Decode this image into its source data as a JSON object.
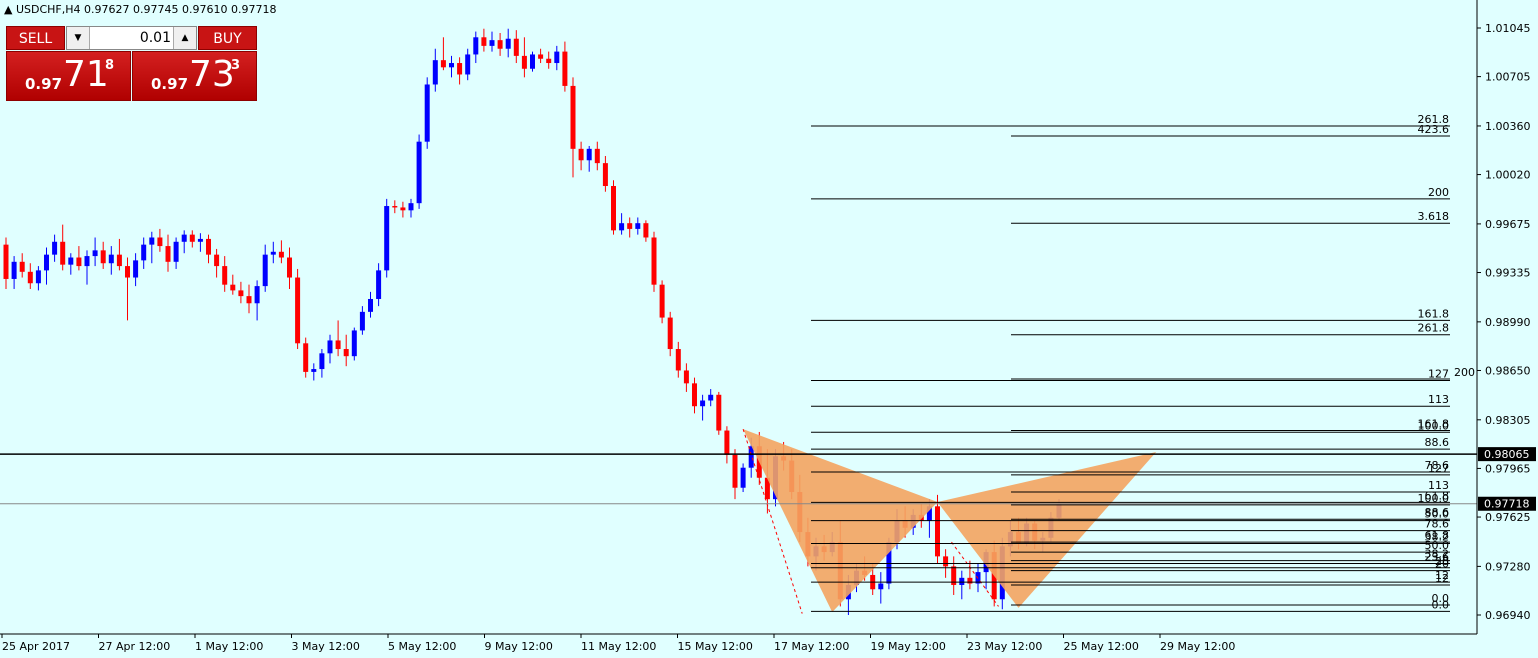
{
  "header": {
    "symbol": "USDCHF,H4",
    "ohlc": "0.97627 0.97745 0.97610 0.97718",
    "collapse_icon": "triangle-up-icon"
  },
  "trade_panel": {
    "sell_label": "SELL",
    "buy_label": "BUY",
    "lot_value": "0.01",
    "sell_price_prefix": "0.97",
    "sell_price_big": "71",
    "sell_price_sup": "8",
    "buy_price_prefix": "0.97",
    "buy_price_big": "73",
    "buy_price_sup": "3"
  },
  "colors": {
    "background": "#e0ffff",
    "bull_candle": "#0000ff",
    "bear_candle": "#ff0000",
    "pattern_fill": "#f4a460",
    "button_red": "#c81414"
  },
  "chart_data": {
    "type": "candlestick",
    "symbol": "USDCHF",
    "timeframe": "H4",
    "y_ticks": [
      "1.01045",
      "1.00705",
      "1.00360",
      "1.00020",
      "0.99675",
      "0.99335",
      "0.98990",
      "0.98650",
      "0.98305",
      "0.97965",
      "0.97625",
      "0.97280",
      "0.96940"
    ],
    "ylim": [
      0.9685,
      1.0125
    ],
    "x_ticks": [
      "25 Apr 2017",
      "27 Apr 12:00",
      "1 May 12:00",
      "3 May 12:00",
      "5 May 12:00",
      "9 May 12:00",
      "11 May 12:00",
      "15 May 12:00",
      "17 May 12:00",
      "19 May 12:00",
      "23 May 12:00",
      "25 May 12:00",
      "29 May 12:00"
    ],
    "price_labels": [
      {
        "value": "0.98065",
        "style": "black"
      },
      {
        "value": "0.97718",
        "style": "black"
      }
    ],
    "horizontal_lines": [
      {
        "price": 0.98065,
        "kind": "level"
      },
      {
        "price": 0.97718,
        "kind": "bid"
      }
    ],
    "candles": [
      [
        0.9953,
        0.9958,
        0.9922,
        0.9929
      ],
      [
        0.9929,
        0.9945,
        0.9922,
        0.9941
      ],
      [
        0.9941,
        0.9947,
        0.993,
        0.9934
      ],
      [
        0.9934,
        0.994,
        0.9922,
        0.9926
      ],
      [
        0.9926,
        0.9938,
        0.9921,
        0.9935
      ],
      [
        0.9935,
        0.9951,
        0.9925,
        0.9946
      ],
      [
        0.9946,
        0.996,
        0.9941,
        0.9955
      ],
      [
        0.9955,
        0.9967,
        0.9935,
        0.9939
      ],
      [
        0.9939,
        0.9947,
        0.9932,
        0.9944
      ],
      [
        0.9944,
        0.9952,
        0.9935,
        0.9938
      ],
      [
        0.9938,
        0.9949,
        0.9925,
        0.9945
      ],
      [
        0.9945,
        0.9958,
        0.9938,
        0.9949
      ],
      [
        0.9949,
        0.9955,
        0.9936,
        0.994
      ],
      [
        0.994,
        0.9952,
        0.9932,
        0.9946
      ],
      [
        0.9946,
        0.9957,
        0.9935,
        0.9938
      ],
      [
        0.9938,
        0.9944,
        0.99,
        0.993
      ],
      [
        0.993,
        0.9947,
        0.9924,
        0.9942
      ],
      [
        0.9942,
        0.9958,
        0.9936,
        0.9953
      ],
      [
        0.9953,
        0.9962,
        0.994,
        0.9958
      ],
      [
        0.9958,
        0.9964,
        0.9948,
        0.9952
      ],
      [
        0.9952,
        0.996,
        0.9934,
        0.9941
      ],
      [
        0.9941,
        0.9958,
        0.9936,
        0.9955
      ],
      [
        0.9955,
        0.9963,
        0.9947,
        0.996
      ],
      [
        0.996,
        0.9963,
        0.9951,
        0.9955
      ],
      [
        0.9955,
        0.9961,
        0.9948,
        0.9957
      ],
      [
        0.9957,
        0.996,
        0.994,
        0.9946
      ],
      [
        0.9946,
        0.995,
        0.993,
        0.9938
      ],
      [
        0.9938,
        0.9945,
        0.992,
        0.9925
      ],
      [
        0.9925,
        0.9932,
        0.9918,
        0.9921
      ],
      [
        0.9921,
        0.9927,
        0.9912,
        0.9917
      ],
      [
        0.9917,
        0.9925,
        0.9905,
        0.9912
      ],
      [
        0.9912,
        0.9928,
        0.99,
        0.9924
      ],
      [
        0.9924,
        0.9953,
        0.992,
        0.9946
      ],
      [
        0.9946,
        0.9955,
        0.994,
        0.9948
      ],
      [
        0.9948,
        0.9956,
        0.994,
        0.9944
      ],
      [
        0.9944,
        0.9951,
        0.9922,
        0.993
      ],
      [
        0.993,
        0.9936,
        0.988,
        0.9884
      ],
      [
        0.9884,
        0.9888,
        0.986,
        0.9864
      ],
      [
        0.9864,
        0.987,
        0.9858,
        0.9866
      ],
      [
        0.9866,
        0.988,
        0.986,
        0.9877
      ],
      [
        0.9877,
        0.989,
        0.987,
        0.9886
      ],
      [
        0.9886,
        0.99,
        0.9875,
        0.988
      ],
      [
        0.988,
        0.989,
        0.9868,
        0.9875
      ],
      [
        0.9875,
        0.9895,
        0.9872,
        0.9893
      ],
      [
        0.9893,
        0.991,
        0.989,
        0.9906
      ],
      [
        0.9906,
        0.992,
        0.9902,
        0.9915
      ],
      [
        0.9915,
        0.994,
        0.991,
        0.9935
      ],
      [
        0.9935,
        0.9985,
        0.993,
        0.998
      ],
      [
        0.998,
        0.9984,
        0.9975,
        0.9979
      ],
      [
        0.9979,
        0.9983,
        0.9972,
        0.9977
      ],
      [
        0.9977,
        0.9985,
        0.9972,
        0.9982
      ],
      [
        0.9982,
        1.003,
        0.9978,
        1.0025
      ],
      [
        1.0025,
        1.007,
        1.002,
        1.0065
      ],
      [
        1.0065,
        1.009,
        1.006,
        1.0082
      ],
      [
        1.0082,
        1.0098,
        1.0075,
        1.0077
      ],
      [
        1.0077,
        1.0085,
        1.007,
        1.008
      ],
      [
        1.008,
        1.0084,
        1.0065,
        1.0072
      ],
      [
        1.0072,
        1.009,
        1.0068,
        1.0086
      ],
      [
        1.0086,
        1.0102,
        1.008,
        1.0098
      ],
      [
        1.0098,
        1.0104,
        1.0088,
        1.0092
      ],
      [
        1.0092,
        1.0102,
        1.0088,
        1.0096
      ],
      [
        1.0096,
        1.0101,
        1.0085,
        1.009
      ],
      [
        1.009,
        1.0104,
        1.0084,
        1.0097
      ],
      [
        1.0097,
        1.0103,
        1.008,
        1.0085
      ],
      [
        1.0085,
        1.0098,
        1.007,
        1.0076
      ],
      [
        1.0076,
        1.0088,
        1.0074,
        1.0086
      ],
      [
        1.0086,
        1.009,
        1.008,
        1.0083
      ],
      [
        1.0083,
        1.0088,
        1.0076,
        1.008
      ],
      [
        1.008,
        1.0092,
        1.0075,
        1.0088
      ],
      [
        1.0088,
        1.0095,
        1.006,
        1.0064
      ],
      [
        1.0064,
        1.007,
        1.0,
        1.002
      ],
      [
        1.002,
        1.0025,
        1.0005,
        1.0012
      ],
      [
        1.0012,
        1.0022,
        1.0004,
        1.002
      ],
      [
        1.002,
        1.0025,
        1.0005,
        1.001
      ],
      [
        1.001,
        1.0015,
        0.999,
        0.9994
      ],
      [
        0.9994,
        0.9998,
        0.996,
        0.9963
      ],
      [
        0.9963,
        0.9975,
        0.996,
        0.9968
      ],
      [
        0.9968,
        0.9972,
        0.9958,
        0.9964
      ],
      [
        0.9964,
        0.9972,
        0.996,
        0.9968
      ],
      [
        0.9968,
        0.997,
        0.9955,
        0.9958
      ],
      [
        0.9958,
        0.9962,
        0.992,
        0.9925
      ],
      [
        0.9925,
        0.9928,
        0.9898,
        0.9902
      ],
      [
        0.9902,
        0.9906,
        0.9875,
        0.988
      ],
      [
        0.988,
        0.9885,
        0.986,
        0.9865
      ],
      [
        0.9865,
        0.987,
        0.985,
        0.9856
      ],
      [
        0.9856,
        0.986,
        0.9835,
        0.984
      ],
      [
        0.984,
        0.9848,
        0.983,
        0.9844
      ],
      [
        0.9844,
        0.9852,
        0.984,
        0.9848
      ],
      [
        0.9848,
        0.985,
        0.982,
        0.9823
      ],
      [
        0.9823,
        0.9826,
        0.98,
        0.9806
      ],
      [
        0.9806,
        0.981,
        0.9775,
        0.9783
      ],
      [
        0.9783,
        0.98,
        0.978,
        0.9797
      ],
      [
        0.9797,
        0.9818,
        0.979,
        0.9812
      ],
      [
        0.9812,
        0.9822,
        0.9785,
        0.979
      ],
      [
        0.979,
        0.981,
        0.9765,
        0.9775
      ],
      [
        0.9775,
        0.981,
        0.977,
        0.9805
      ],
      [
        0.9805,
        0.9815,
        0.9795,
        0.9802
      ],
      [
        0.9802,
        0.981,
        0.9775,
        0.978
      ],
      [
        0.978,
        0.9792,
        0.9745,
        0.9752
      ],
      [
        0.9752,
        0.9762,
        0.9728,
        0.9735
      ],
      [
        0.9735,
        0.9748,
        0.9725,
        0.9742
      ],
      [
        0.9742,
        0.975,
        0.9732,
        0.9738
      ],
      [
        0.9738,
        0.9752,
        0.9735,
        0.9745
      ],
      [
        0.9745,
        0.976,
        0.97,
        0.9705
      ],
      [
        0.9705,
        0.9722,
        0.9694,
        0.9715
      ],
      [
        0.9715,
        0.973,
        0.971,
        0.9725
      ],
      [
        0.9725,
        0.9735,
        0.9718,
        0.9722
      ],
      [
        0.9722,
        0.973,
        0.9708,
        0.9712
      ],
      [
        0.9712,
        0.9724,
        0.9702,
        0.9716
      ],
      [
        0.9716,
        0.9748,
        0.9712,
        0.9745
      ],
      [
        0.9745,
        0.9768,
        0.974,
        0.976
      ],
      [
        0.976,
        0.977,
        0.9748,
        0.9755
      ],
      [
        0.9755,
        0.9768,
        0.975,
        0.9764
      ],
      [
        0.9764,
        0.9772,
        0.9755,
        0.976
      ],
      [
        0.976,
        0.9775,
        0.9748,
        0.977
      ],
      [
        0.977,
        0.9778,
        0.973,
        0.9735
      ],
      [
        0.9735,
        0.974,
        0.972,
        0.9728
      ],
      [
        0.9728,
        0.9735,
        0.9708,
        0.9715
      ],
      [
        0.9715,
        0.9725,
        0.9705,
        0.972
      ],
      [
        0.972,
        0.9732,
        0.9712,
        0.9716
      ],
      [
        0.9716,
        0.973,
        0.971,
        0.9724
      ],
      [
        0.9724,
        0.974,
        0.9712,
        0.9738
      ],
      [
        0.9738,
        0.9746,
        0.97,
        0.9705
      ],
      [
        0.9705,
        0.9748,
        0.9698,
        0.9742
      ],
      [
        0.9742,
        0.976,
        0.9735,
        0.9752
      ],
      [
        0.9752,
        0.9762,
        0.974,
        0.9744
      ],
      [
        0.9744,
        0.9762,
        0.9742,
        0.9758
      ],
      [
        0.9758,
        0.976,
        0.974,
        0.9746
      ],
      [
        0.9746,
        0.9752,
        0.9738,
        0.9748
      ],
      [
        0.9748,
        0.9766,
        0.9745,
        0.9762
      ],
      [
        0.9762,
        0.9775,
        0.976,
        0.9772
      ]
    ],
    "fibo_set_left": [
      "261.8",
      "200",
      "161.8",
      "127",
      "113",
      "100.0",
      "88.6",
      "78.6",
      "61.8",
      "50.0",
      "38.2",
      "23.6",
      "20",
      "12",
      "0.0"
    ],
    "fibo_set_left_prices": [
      1.0036,
      0.9985,
      0.99,
      0.9858,
      0.984,
      0.98218,
      0.981,
      0.9794,
      0.97728,
      0.976,
      0.9744,
      0.973,
      0.9727,
      0.9717,
      0.96965
    ],
    "fibo_set_right": [
      "423.6",
      "3.618",
      "261.8",
      "200",
      "161.8",
      "127",
      "113",
      "100.0",
      "88.6",
      "78.6",
      "61.8",
      "50.0",
      "38.2",
      "20",
      "12",
      "0.0"
    ],
    "fibo_set_right_prices": [
      1.0029,
      0.9968,
      0.989,
      0.9859,
      0.9823,
      0.9792,
      0.978,
      0.9771,
      0.9761,
      0.9753,
      0.9745,
      0.9738,
      0.9732,
      0.9725,
      0.9715,
      0.9701
    ],
    "fibo_set_right_labels_offset": [
      "",
      "",
      "",
      "200",
      "",
      "",
      "",
      "",
      "",
      "",
      "",
      "",
      "",
      "",
      "",
      ""
    ],
    "pattern": {
      "type": "harmonic-butterfly",
      "points": [
        {
          "x_index": 91,
          "price": 0.9824
        },
        {
          "x_index": 102,
          "price": 0.9696
        },
        {
          "x_index": 115,
          "price": 0.9773
        },
        {
          "x_index": 125,
          "price": 0.9699
        },
        {
          "x_index": 142,
          "price": 0.9808
        }
      ]
    }
  }
}
